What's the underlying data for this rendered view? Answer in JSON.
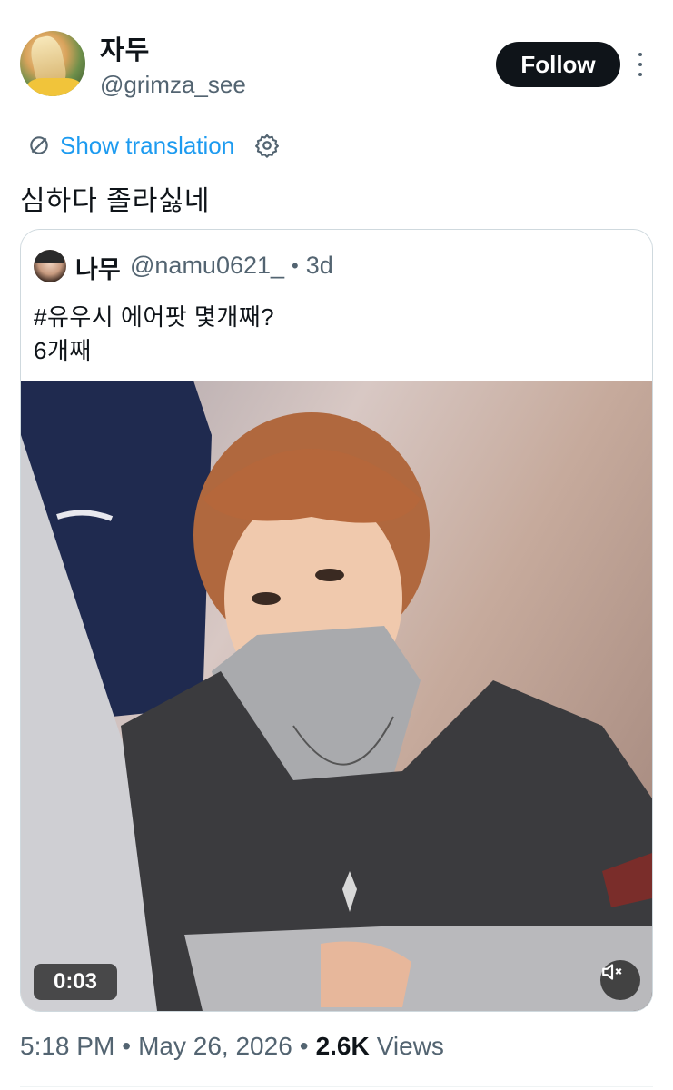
{
  "author": {
    "display_name": "자두",
    "handle": "@grimza_see",
    "follow_label": "Follow"
  },
  "translation": {
    "link_label": "Show translation"
  },
  "tweet": {
    "text": "심하다 졸라싫네"
  },
  "quoted": {
    "display_name": "나무",
    "handle": "@namu0621_",
    "separator": "•",
    "age": "3d",
    "text_line1": "#유우시 에어팟 몇개째?",
    "text_line2": "6개째",
    "video": {
      "duration": "0:03",
      "muted": true
    }
  },
  "meta": {
    "time": "5:18 PM",
    "separator": "•",
    "date": "May 26, 2026",
    "views_count": "2.6K",
    "views_label": "Views"
  },
  "colors": {
    "accent": "#1d9bf0",
    "text_primary": "#0f1419",
    "text_secondary": "#536471",
    "border": "#cfd9de"
  }
}
